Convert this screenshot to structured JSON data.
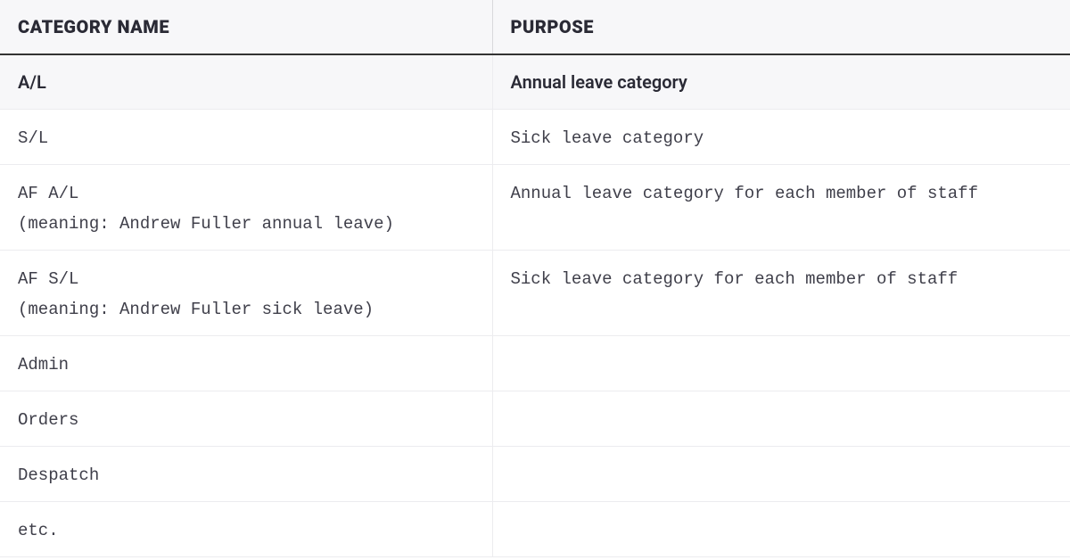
{
  "table": {
    "headers": {
      "category": "CATEGORY NAME",
      "purpose": "PURPOSE"
    },
    "rows": [
      {
        "category": "A/L",
        "meaning": "",
        "purpose": "Annual leave category",
        "highlight": true,
        "sans": true
      },
      {
        "category": "S/L",
        "meaning": "",
        "purpose": "Sick leave category",
        "highlight": false,
        "sans": false
      },
      {
        "category": "AF A/L",
        "meaning": "(meaning: Andrew Fuller annual leave)",
        "purpose": "Annual leave category for each member of staff",
        "highlight": false,
        "sans": false
      },
      {
        "category": "AF S/L",
        "meaning": "(meaning: Andrew Fuller sick leave)",
        "purpose": "Sick leave category for each member of staff",
        "highlight": false,
        "sans": false
      },
      {
        "category": "Admin",
        "meaning": "",
        "purpose": "",
        "highlight": false,
        "sans": false
      },
      {
        "category": "Orders",
        "meaning": "",
        "purpose": "",
        "highlight": false,
        "sans": false
      },
      {
        "category": "Despatch",
        "meaning": "",
        "purpose": "",
        "highlight": false,
        "sans": false
      },
      {
        "category": "etc.",
        "meaning": "",
        "purpose": "",
        "highlight": false,
        "sans": false
      }
    ]
  }
}
